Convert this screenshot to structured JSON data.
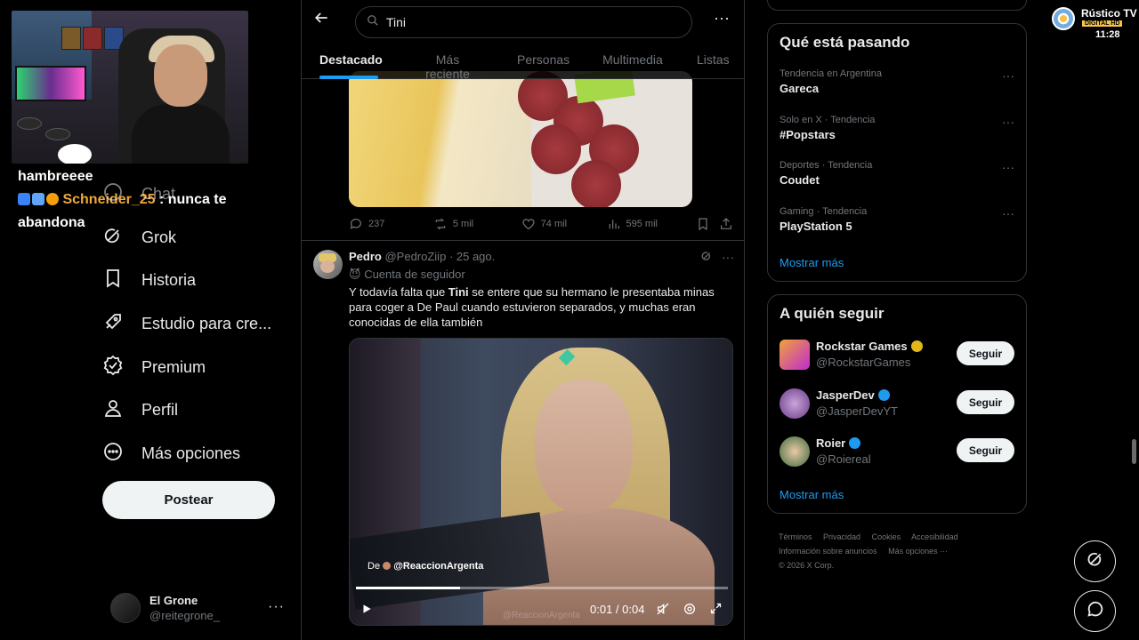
{
  "overlay": {
    "chat_line1": "hambreeee",
    "chat_user": "Schneider_25",
    "chat_msg": ": nunca te",
    "chat_line3": "abandona"
  },
  "nav": {
    "items": [
      {
        "label": "Chat",
        "icon": "chat-icon"
      },
      {
        "label": "Grok",
        "icon": "grok-icon"
      },
      {
        "label": "Historia",
        "icon": "bookmark-icon"
      },
      {
        "label": "Estudio para cre...",
        "icon": "rocket-icon"
      },
      {
        "label": "Premium",
        "icon": "verified-icon"
      },
      {
        "label": "Perfil",
        "icon": "person-icon"
      },
      {
        "label": "Más opciones",
        "icon": "more-circle-icon"
      }
    ],
    "post_label": "Postear",
    "account": {
      "name": "El Grone",
      "handle": "@reitegrone_"
    }
  },
  "search": {
    "query": "Tini"
  },
  "tabs": [
    "Destacado",
    "Más reciente",
    "Personas",
    "Multimedia",
    "Listas"
  ],
  "tweet1": {
    "replies": "237",
    "reposts": "5 mil",
    "likes": "74 mil",
    "views": "595 mil"
  },
  "tweet2": {
    "name": "Pedro",
    "handle": "@PedroZiip",
    "date": "· 25 ago.",
    "follower_label": "Cuenta de seguidor",
    "text_before": "Y todavía falta que ",
    "text_bold": "Tini",
    "text_after": " se entere que su hermano le presentaba minas para coger a De Paul cuando estuvieron separados, y muchas eran conocidas de ella también",
    "video": {
      "watermark_prefix": "De",
      "watermark_handle": "@ReaccionArgenta",
      "ghost_mark": "@ReaccionArgenta",
      "time": "0:01 / 0:04",
      "progress": 0.28
    }
  },
  "trends": {
    "title": "Qué está pasando",
    "items": [
      {
        "category": "Tendencia en Argentina",
        "name": "Gareca"
      },
      {
        "category": "Solo en X · Tendencia",
        "name": "#Popstars"
      },
      {
        "category": "Deportes · Tendencia",
        "name": "Coudet"
      },
      {
        "category": "Gaming · Tendencia",
        "name": "PlayStation 5"
      }
    ],
    "show_more": "Mostrar más"
  },
  "who_to_follow": {
    "title": "A quién seguir",
    "items": [
      {
        "name": "Rockstar Games",
        "handle": "@RockstarGames",
        "badge": "gold",
        "button": "Seguir"
      },
      {
        "name": "JasperDev",
        "handle": "@JasperDevYT",
        "badge": "blue",
        "button": "Seguir"
      },
      {
        "name": "Roier",
        "handle": "@Roiereal",
        "badge": "blue",
        "button": "Seguir"
      }
    ],
    "show_more": "Mostrar más"
  },
  "footer": {
    "links": [
      "Términos",
      "Privacidad",
      "Cookies",
      "Accesibilidad",
      "Información sobre anuncios",
      "Más opciones ···"
    ],
    "copyright": "© 2026 X Corp."
  },
  "tv": {
    "channel": "Rústico TV",
    "digital": "DIGITAL HD",
    "clock": "11:28"
  },
  "colors": {
    "accent": "#1d9bf0",
    "background": "#000000",
    "muted": "#71767b",
    "gold_badge": "#e2b719",
    "blue_badge": "#1d9bf0"
  }
}
